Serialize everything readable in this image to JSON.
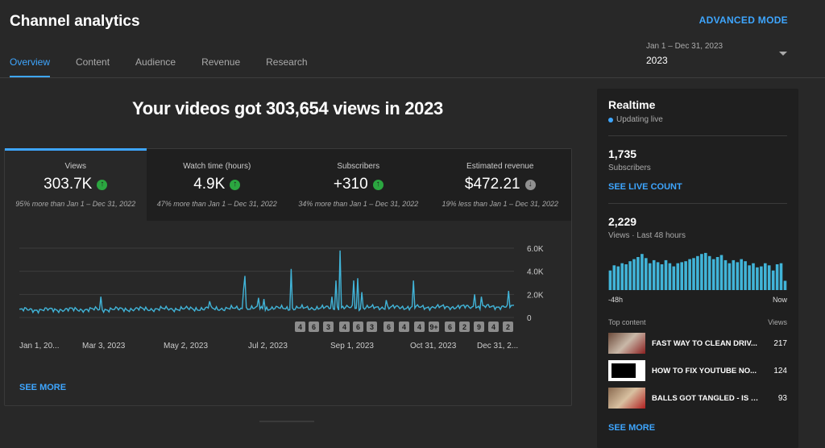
{
  "page": {
    "title": "Channel analytics",
    "advanced_mode": "ADVANCED MODE",
    "tabs": [
      "Overview",
      "Content",
      "Audience",
      "Revenue",
      "Research"
    ],
    "active_tab": "Overview",
    "date_range": {
      "range": "Jan 1 – Dec 31, 2023",
      "label": "2023"
    }
  },
  "headline": "Your videos got 303,654 views in 2023",
  "metrics": [
    {
      "label": "Views",
      "value": "303.7K",
      "trend": "up",
      "comparison": "95% more than Jan 1 – Dec 31, 2022"
    },
    {
      "label": "Watch time (hours)",
      "value": "4.9K",
      "trend": "up",
      "comparison": "47% more than Jan 1 – Dec 31, 2022"
    },
    {
      "label": "Subscribers",
      "value": "+310",
      "trend": "up",
      "comparison": "34% more than Jan 1 – Dec 31, 2022"
    },
    {
      "label": "Estimated revenue",
      "value": "$472.21",
      "trend": "down",
      "comparison": "19% less than Jan 1 – Dec 31, 2022"
    }
  ],
  "chart_data": {
    "type": "line",
    "series": [
      {
        "color": "#41b4d8"
      }
    ],
    "x_tick_labels": [
      "Jan 1, 20...",
      "Mar 3, 2023",
      "May 2, 2023",
      "Jul 2, 2023",
      "Sep 1, 2023",
      "Oct 31, 2023",
      "Dec 31, 2..."
    ],
    "y_tick_labels": [
      "0",
      "2.0K",
      "4.0K",
      "6.0K"
    ],
    "ylim": [
      0,
      6000
    ],
    "grid": true,
    "baseline": 650,
    "spikes": [
      {
        "day": 60,
        "value": 1800
      },
      {
        "day": 140,
        "value": 1400
      },
      {
        "day": 165,
        "value": 2400
      },
      {
        "day": 166,
        "value": 3600
      },
      {
        "day": 176,
        "value": 1700
      },
      {
        "day": 180,
        "value": 1600
      },
      {
        "day": 200,
        "value": 4200
      },
      {
        "day": 230,
        "value": 1800
      },
      {
        "day": 233,
        "value": 3200
      },
      {
        "day": 236,
        "value": 5800
      },
      {
        "day": 246,
        "value": 3200
      },
      {
        "day": 249,
        "value": 3400
      },
      {
        "day": 252,
        "value": 2200
      },
      {
        "day": 270,
        "value": 1500
      },
      {
        "day": 290,
        "value": 3200
      },
      {
        "day": 335,
        "value": 2000
      },
      {
        "day": 340,
        "value": 1800
      },
      {
        "day": 360,
        "value": 2300
      }
    ],
    "event_markers": [
      "4",
      "6",
      "3",
      "4",
      "6",
      "3",
      "6",
      "4",
      "4",
      "9+",
      "6",
      "2",
      "9",
      "4",
      "2"
    ]
  },
  "see_more": "SEE MORE",
  "realtime": {
    "title": "Realtime",
    "status": "Updating live",
    "subscribers_value": "1,735",
    "subscribers_label": "Subscribers",
    "live_count_link": "SEE LIVE COUNT",
    "views_value": "2,229",
    "views_label": "Views · Last 48 hours",
    "hourly_views": [
      38,
      48,
      46,
      52,
      50,
      56,
      60,
      64,
      70,
      62,
      52,
      58,
      54,
      50,
      58,
      52,
      46,
      52,
      54,
      56,
      60,
      62,
      66,
      70,
      72,
      66,
      60,
      64,
      68,
      58,
      52,
      58,
      54,
      60,
      56,
      48,
      52,
      44,
      46,
      52,
      48,
      38,
      50,
      52,
      18
    ],
    "axis_start": "-48h",
    "axis_end": "Now",
    "top_content_label": "Top content",
    "top_views_label": "Views",
    "top_content": [
      {
        "title": "FAST WAY TO CLEAN DRIV...",
        "views": "217"
      },
      {
        "title": "HOW TO FIX YOUTUBE NO...",
        "views": "124"
      },
      {
        "title": "BALLS GOT TANGLED - IS T...",
        "views": "93"
      }
    ],
    "see_more": "SEE MORE"
  }
}
